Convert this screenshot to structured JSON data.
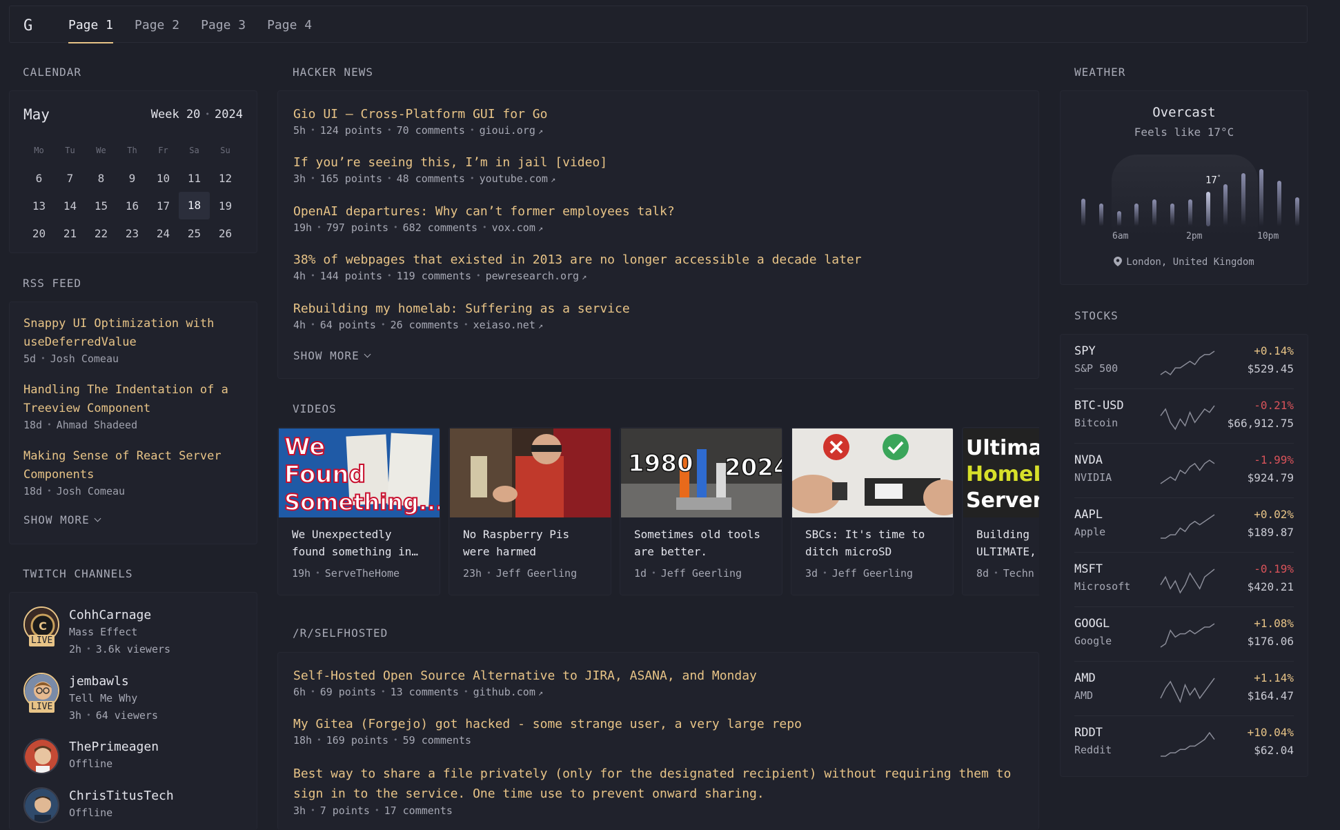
{
  "header": {
    "logo": "G",
    "tabs": [
      "Page 1",
      "Page 2",
      "Page 3",
      "Page 4"
    ]
  },
  "calendar": {
    "title": "CALENDAR",
    "month": "May",
    "week_label": "Week 20",
    "year": "2024",
    "dow": [
      "Mo",
      "Tu",
      "We",
      "Th",
      "Fr",
      "Sa",
      "Su"
    ],
    "rows": [
      [
        "6",
        "7",
        "8",
        "9",
        "10",
        "11",
        "12"
      ],
      [
        "13",
        "14",
        "15",
        "16",
        "17",
        "18",
        "19"
      ],
      [
        "20",
        "21",
        "22",
        "23",
        "24",
        "25",
        "26"
      ]
    ],
    "today": "18"
  },
  "rss": {
    "title": "RSS FEED",
    "items": [
      {
        "title": "Snappy UI Optimization with useDeferredValue",
        "age": "5d",
        "author": "Josh Comeau"
      },
      {
        "title": "Handling The Indentation of a Treeview Component",
        "age": "18d",
        "author": "Ahmad Shadeed"
      },
      {
        "title": "Making Sense of React Server Components",
        "age": "18d",
        "author": "Josh Comeau"
      }
    ],
    "show_more": "SHOW MORE"
  },
  "twitch": {
    "title": "TWITCH CHANNELS",
    "live_label": "LIVE",
    "channels": [
      {
        "name": "CohhCarnage",
        "game": "Mass Effect",
        "age": "2h",
        "viewers": "3.6k viewers"
      },
      {
        "name": "jembawls",
        "game": "Tell Me Why",
        "age": "3h",
        "viewers": "64 viewers"
      },
      {
        "name": "ThePrimeagen",
        "status": "Offline"
      },
      {
        "name": "ChrisTitusTech",
        "status": "Offline"
      }
    ]
  },
  "hacker_news": {
    "title": "HACKER NEWS",
    "items": [
      {
        "title": "Gio UI – Cross-Platform GUI for Go",
        "age": "5h",
        "points": "124 points",
        "comments": "70 comments",
        "domain": "gioui.org"
      },
      {
        "title": "If you’re seeing this, I’m in jail [video]",
        "age": "3h",
        "points": "165 points",
        "comments": "48 comments",
        "domain": "youtube.com"
      },
      {
        "title": "OpenAI departures: Why can’t former employees talk?",
        "age": "19h",
        "points": "797 points",
        "comments": "682 comments",
        "domain": "vox.com"
      },
      {
        "title": "38% of webpages that existed in 2013 are no longer accessible a decade later",
        "age": "4h",
        "points": "144 points",
        "comments": "119 comments",
        "domain": "pewresearch.org"
      },
      {
        "title": "Rebuilding my homelab: Suffering as a service",
        "age": "4h",
        "points": "64 points",
        "comments": "26 comments",
        "domain": "xeiaso.net"
      }
    ],
    "show_more": "SHOW MORE"
  },
  "videos": {
    "title": "VIDEOS",
    "items": [
      {
        "title1": "We Unexpectedly",
        "title2": "found something in…",
        "age": "19h",
        "channel": "ServeTheHome",
        "thumb_text": [
          "We",
          "Found",
          "Something..."
        ]
      },
      {
        "title1": "No Raspberry Pis",
        "title2": "were harmed",
        "age": "23h",
        "channel": "Jeff Geerling"
      },
      {
        "title1": "Sometimes old tools",
        "title2": "are better.",
        "age": "1d",
        "channel": "Jeff Geerling",
        "thumb_text": [
          "1980",
          "2024"
        ]
      },
      {
        "title1": "SBCs: It's time to",
        "title2": "ditch microSD",
        "age": "3d",
        "channel": "Jeff Geerling"
      },
      {
        "title1": "Building",
        "title2": "ULTIMATE,",
        "age": "8d",
        "channel": "Techn",
        "thumb_text": [
          "Ultimate",
          "HomeLab",
          "Server"
        ]
      }
    ]
  },
  "selfhosted": {
    "title": "/R/SELFHOSTED",
    "items": [
      {
        "title": "Self-Hosted Open Source Alternative to JIRA, ASANA, and Monday",
        "age": "6h",
        "points": "69 points",
        "comments": "13 comments",
        "domain": "github.com"
      },
      {
        "title": "My Gitea (Forgejo) got hacked - some strange user, a very large repo",
        "age": "18h",
        "points": "169 points",
        "comments": "59 comments"
      },
      {
        "title1": "Best way to share a file privately (only for the designated recipient) without requiring them to",
        "title2": "sign in to the service. One time use to prevent onward sharing.",
        "age": "3h",
        "points": "7 points",
        "comments": "17 comments"
      }
    ]
  },
  "weather": {
    "title": "WEATHER",
    "condition": "Overcast",
    "feels_like": "Feels like 17°C",
    "current_temp": "17",
    "hour_labels": [
      "6am",
      "2pm",
      "10pm"
    ],
    "location": "London, United Kingdom",
    "bars": [
      0.36,
      0.3,
      0.2,
      0.3,
      0.35,
      0.3,
      0.35,
      0.45,
      0.55,
      0.7,
      0.75,
      0.6,
      0.38
    ]
  },
  "stocks": {
    "title": "STOCKS",
    "items": [
      {
        "symbol": "SPY",
        "name": "S&P 500",
        "change": "+0.14%",
        "price": "$529.45",
        "dir": "up",
        "spark": [
          2,
          3,
          2,
          4,
          4,
          5,
          6,
          5,
          7,
          8,
          8,
          9
        ]
      },
      {
        "symbol": "BTC-USD",
        "name": "Bitcoin",
        "change": "-0.21%",
        "price": "$66,912.75",
        "dir": "down",
        "spark": [
          6,
          8,
          4,
          2,
          5,
          3,
          7,
          4,
          6,
          8,
          7,
          9
        ]
      },
      {
        "symbol": "NVDA",
        "name": "NVIDIA",
        "change": "-1.99%",
        "price": "$924.79",
        "dir": "down",
        "spark": [
          2,
          3,
          4,
          3,
          6,
          5,
          7,
          8,
          6,
          8,
          9,
          8
        ]
      },
      {
        "symbol": "AAPL",
        "name": "Apple",
        "change": "+0.02%",
        "price": "$189.87",
        "dir": "up",
        "spark": [
          2,
          2,
          3,
          3,
          5,
          4,
          6,
          7,
          6,
          7,
          8,
          9
        ]
      },
      {
        "symbol": "MSFT",
        "name": "Microsoft",
        "change": "-0.19%",
        "price": "$420.21",
        "dir": "down",
        "spark": [
          5,
          7,
          4,
          6,
          3,
          5,
          8,
          6,
          4,
          7,
          8,
          9
        ]
      },
      {
        "symbol": "GOOGL",
        "name": "Google",
        "change": "+1.08%",
        "price": "$176.06",
        "dir": "up",
        "spark": [
          2,
          3,
          7,
          5,
          6,
          6,
          7,
          6,
          7,
          8,
          8,
          9
        ]
      },
      {
        "symbol": "AMD",
        "name": "AMD",
        "change": "+1.14%",
        "price": "$164.47",
        "dir": "up",
        "spark": [
          3,
          6,
          8,
          5,
          2,
          7,
          4,
          6,
          3,
          5,
          7,
          9
        ]
      },
      {
        "symbol": "RDDT",
        "name": "Reddit",
        "change": "+10.04%",
        "price": "$62.04",
        "dir": "up",
        "spark": [
          2,
          2,
          3,
          3,
          4,
          4,
          5,
          5,
          6,
          7,
          9,
          7
        ]
      }
    ]
  },
  "colors": {
    "accent": "#e8c487",
    "negative": "#d9535a",
    "background": "#1e2029"
  }
}
